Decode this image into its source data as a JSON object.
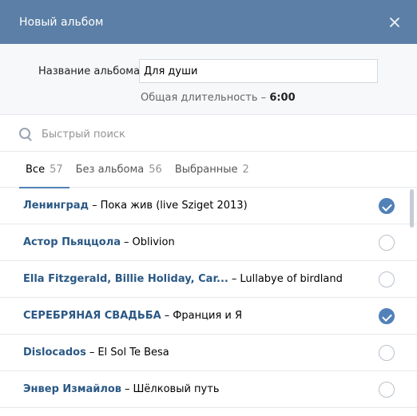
{
  "header": {
    "title": "Новый альбом",
    "close_icon": "close-icon"
  },
  "album": {
    "name_label": "Название альбома",
    "name_value": "Для души",
    "duration_label": "Общая длительность –",
    "duration_value": "6:00"
  },
  "search": {
    "icon": "search-icon",
    "placeholder": "Быстрый поиск"
  },
  "tabs": [
    {
      "label": "Все",
      "count": "57",
      "active": true
    },
    {
      "label": "Без альбома",
      "count": "56",
      "active": false
    },
    {
      "label": "Выбранные",
      "count": "2",
      "active": false
    }
  ],
  "tracks": [
    {
      "artist": "Ленинград",
      "title": "Пока жив (live Sziget 2013)",
      "selected": true
    },
    {
      "artist": "Астор Пьяццола",
      "title": "Oblivion",
      "selected": false
    },
    {
      "artist": "Ella Fitzgerald, Billie Holiday, Car...",
      "title": "Lullabye of birdland",
      "selected": false
    },
    {
      "artist": "СЕРЕБРЯНАЯ СВАДЬБА",
      "title": "Франция и Я",
      "selected": true
    },
    {
      "artist": "Dislocados",
      "title": "El Sol Te Besa",
      "selected": false
    },
    {
      "artist": "Энвер Измайлов",
      "title": "Шёлковый путь",
      "selected": false
    }
  ],
  "colors": {
    "header_bg": "#5b7fa6",
    "accent": "#5181b8",
    "artist": "#2a5885"
  }
}
